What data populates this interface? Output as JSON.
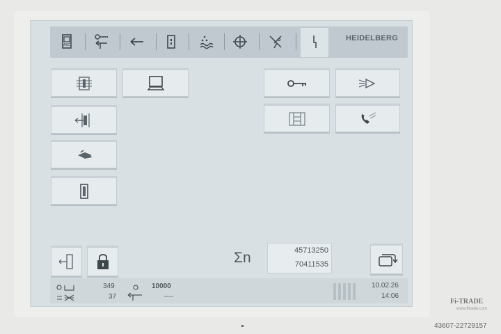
{
  "header": {
    "brand": "HEIDELBERG",
    "tabs": [
      {
        "icon": "document-icon"
      },
      {
        "icon": "feeder-setup-icon"
      },
      {
        "icon": "arrow-left-icon"
      },
      {
        "icon": "door-icon"
      },
      {
        "icon": "dampening-icon"
      },
      {
        "icon": "registration-crosshair-icon"
      },
      {
        "icon": "scissors-icon"
      },
      {
        "icon": "service-icon"
      }
    ]
  },
  "main": {
    "left_buttons": [
      {
        "icon": "device-settings-icon"
      },
      {
        "icon": "monitor-icon"
      },
      {
        "icon": "feeder-entry-icon"
      },
      {
        "icon": "hand-icon"
      },
      {
        "icon": "panel-icon"
      }
    ],
    "right_buttons": [
      {
        "icon": "key-icon"
      },
      {
        "icon": "lamp-icon"
      },
      {
        "icon": "diagram-icon"
      },
      {
        "icon": "phone-icon"
      }
    ],
    "bottom_left_buttons": [
      {
        "icon": "exit-icon"
      },
      {
        "icon": "lock-icon"
      }
    ],
    "counter": {
      "label": "Σn",
      "value1": "45713250",
      "value2": "70411535"
    },
    "cycle_button": {
      "icon": "cycle-icon"
    }
  },
  "status": {
    "count_top": "349",
    "count_bottom": "37",
    "target_top": "10000",
    "target_bottom": "----",
    "date": "10.02.26",
    "time": "14:06"
  },
  "watermark": {
    "logo": "Fi-TRADE",
    "site": "www.fitrade.com",
    "id": "43607-22729157"
  }
}
